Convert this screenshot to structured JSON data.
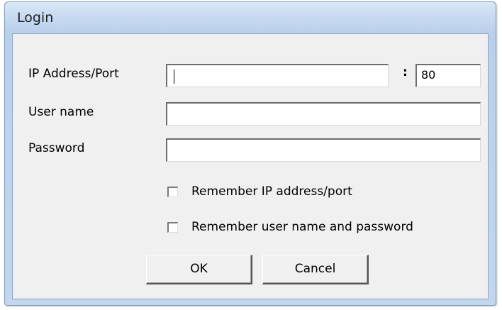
{
  "window": {
    "title": "Login"
  },
  "form": {
    "ip_label": "IP Address/Port",
    "ip_value": "",
    "port_separator": ":",
    "port_value": "80",
    "username_label": "User name",
    "username_value": "",
    "password_label": "Password",
    "password_value": ""
  },
  "options": {
    "remember_ip_label": "Remember IP address/port",
    "remember_ip_checked": false,
    "remember_credentials_label": "Remember user name and password",
    "remember_credentials_checked": false
  },
  "buttons": {
    "ok_label": "OK",
    "cancel_label": "Cancel"
  }
}
